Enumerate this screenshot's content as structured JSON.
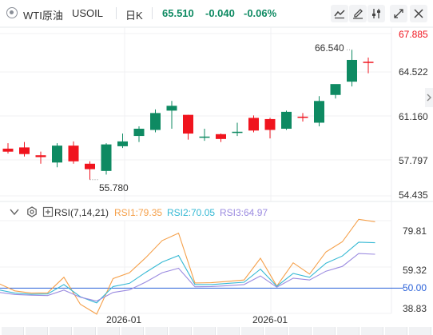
{
  "toolbar": {
    "symbol_name": "WTI原油",
    "symbol_code": "USOIL",
    "interval": "日K",
    "price": "65.510",
    "change": "-0.040",
    "change_pct": "-0.06%",
    "colors": {
      "up": "#0e8a62",
      "down": "#f0141e",
      "text": "#333333"
    }
  },
  "chart_data": [
    {
      "type": "candlestick",
      "title": "",
      "y_ticks": [
        "67.885",
        "64.522",
        "61.160",
        "57.797",
        "54.435"
      ],
      "x_ticks": [
        "2026-01",
        "2026-01"
      ],
      "ylim": [
        54.435,
        67.885
      ],
      "annotations": {
        "high_label": "66.540",
        "low_label": "55.780"
      },
      "top_tick_color": "#f0141e",
      "tick_color": "#333333",
      "grid": true,
      "candles": [
        {
          "o": 58.35,
          "h": 58.8,
          "c": 58.1,
          "l": 57.95
        },
        {
          "o": 58.45,
          "h": 58.9,
          "c": 57.9,
          "l": 57.7
        },
        {
          "o": 57.8,
          "h": 58.1,
          "c": 57.65,
          "l": 57.1
        },
        {
          "o": 57.2,
          "h": 58.8,
          "c": 58.6,
          "l": 56.8
        },
        {
          "o": 58.6,
          "h": 58.95,
          "c": 57.3,
          "l": 57.1
        },
        {
          "o": 57.1,
          "h": 57.3,
          "c": 56.65,
          "l": 55.78
        },
        {
          "o": 56.5,
          "h": 58.8,
          "c": 58.7,
          "l": 56.2
        },
        {
          "o": 58.55,
          "h": 59.6,
          "c": 58.95,
          "l": 58.4
        },
        {
          "o": 59.4,
          "h": 60.2,
          "c": 60.0,
          "l": 58.9
        },
        {
          "o": 59.9,
          "h": 61.6,
          "c": 61.3,
          "l": 59.7
        },
        {
          "o": 61.5,
          "h": 62.3,
          "c": 61.9,
          "l": 60.0
        },
        {
          "o": 61.15,
          "h": 61.15,
          "c": 59.6,
          "l": 59.1
        },
        {
          "o": 59.3,
          "h": 60.0,
          "c": 59.35,
          "l": 59.0
        },
        {
          "o": 59.55,
          "h": 59.6,
          "c": 59.15,
          "l": 58.9
        },
        {
          "o": 59.65,
          "h": 60.5,
          "c": 59.75,
          "l": 59.4
        },
        {
          "o": 60.9,
          "h": 61.1,
          "c": 59.85,
          "l": 59.7
        },
        {
          "o": 60.8,
          "h": 60.9,
          "c": 59.9,
          "l": 59.2
        },
        {
          "o": 60.0,
          "h": 61.5,
          "c": 61.4,
          "l": 59.9
        },
        {
          "o": 61.0,
          "h": 61.3,
          "c": 60.95,
          "l": 60.6
        },
        {
          "o": 60.5,
          "h": 62.7,
          "c": 62.3,
          "l": 60.2
        },
        {
          "o": 62.8,
          "h": 63.6,
          "c": 63.7,
          "l": 62.5
        },
        {
          "o": 63.9,
          "h": 66.54,
          "c": 65.7,
          "l": 63.5
        },
        {
          "o": 65.55,
          "h": 65.9,
          "c": 65.51,
          "l": 64.6
        }
      ]
    },
    {
      "type": "line",
      "title": "RSI(7,14,21)",
      "y_ticks": [
        "79.81",
        "59.32",
        "50.00",
        "38.83"
      ],
      "ylim": [
        38.83,
        79.81
      ],
      "reference_line": 50.0,
      "x_ticks": [
        "2026-01",
        "2026-01"
      ],
      "series": [
        {
          "name": "RSI1:79.35",
          "color": "#f5a04a",
          "values": [
            52.1,
            48.8,
            47.8,
            47.9,
            54.8,
            42.9,
            38.5,
            54.2,
            56.8,
            63.5,
            71.0,
            74.3,
            52.3,
            52.4,
            53.0,
            53.6,
            63.2,
            50.9,
            61.2,
            56.2,
            66.0,
            70.5,
            80.4,
            79.35
          ]
        },
        {
          "name": "RSI2:70.05",
          "color": "#36b9d4",
          "values": [
            49.3,
            47.8,
            47.3,
            47.4,
            51.6,
            46.2,
            43.5,
            50.7,
            52.1,
            57.0,
            61.5,
            64.4,
            51.6,
            51.6,
            52.1,
            52.6,
            58.4,
            50.8,
            56.5,
            54.8,
            61.0,
            64.2,
            70.3,
            70.05
          ]
        },
        {
          "name": "RSI3:64.97",
          "color": "#9b8be0",
          "values": [
            48.2,
            47.2,
            46.9,
            46.7,
            49.1,
            46.0,
            44.3,
            48.1,
            49.2,
            52.7,
            56.8,
            58.8,
            50.6,
            50.7,
            51.1,
            51.6,
            55.4,
            50.4,
            54.4,
            53.6,
            57.5,
            59.6,
            65.3,
            64.97
          ]
        }
      ]
    }
  ]
}
